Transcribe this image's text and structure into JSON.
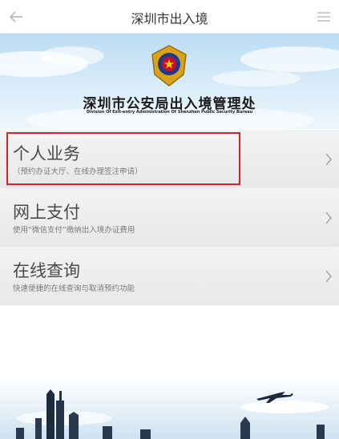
{
  "header": {
    "title": "深圳市出入境",
    "back_icon": "arrow-left-icon",
    "menu_icon": "hamburger-menu-icon"
  },
  "banner": {
    "title": "深圳市公安局出入境管理处",
    "subtitle": "Division Of Exit-entry Administration Of Shenzhen Public Security Bureau",
    "emblem_icon": "police-emblem-icon"
  },
  "menu": {
    "items": [
      {
        "title": "个人业务",
        "subtitle": "（预约办证大厅、在线办理签注申请）"
      },
      {
        "title": "网上支付",
        "subtitle": "使用“微信支付”缴纳出入境办证费用"
      },
      {
        "title": "在线查询",
        "subtitle": "快速便捷的在线查询与取消预约功能"
      }
    ]
  },
  "colors": {
    "highlight": "#e02020",
    "item_title": "#4a4a4a",
    "item_subtitle": "#7a7a7a"
  }
}
